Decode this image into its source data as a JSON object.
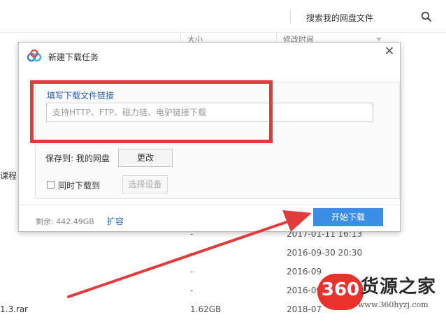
{
  "background": {
    "search_label": "搜索我的网盘文件",
    "columns": {
      "size": "大小",
      "modified": "修改时间"
    },
    "left_fragments": [
      "课程",
      "1.3.rar"
    ],
    "rows": [
      {
        "size": "-",
        "date": "2017-01-11 16:13"
      },
      {
        "size": "-",
        "date": "2016-09-30 20:30"
      },
      {
        "size": "-",
        "date": "2016-09"
      },
      {
        "size": "-",
        "date": "2016-09"
      },
      {
        "size": "1.62GB",
        "date": "2018-07"
      }
    ]
  },
  "dialog": {
    "title": "新建下载任务",
    "close_glyph": "×",
    "field_label": "填写下载文件链接",
    "url_input": {
      "value": "",
      "placeholder": "支持HTTP、FTP、磁力链、电驴链接下载"
    },
    "save_label": "保存到: 我的网盘",
    "change_button": "更改",
    "simultaneous_label": "同时下载到",
    "simultaneous_checked": false,
    "device_button": "选择设备",
    "remaining": "剩余: 442.49GB",
    "expand_link": "扩容",
    "start_button": "开始下载"
  },
  "annotation": {
    "highlight_color": "#e23b3b"
  },
  "watermark": {
    "badge": "360",
    "text": "货源之家",
    "url": "www.360hyzj.com"
  },
  "colors": {
    "primary_button": "#3b8ee6",
    "link": "#2a6fd1",
    "label": "#2a5caa"
  }
}
